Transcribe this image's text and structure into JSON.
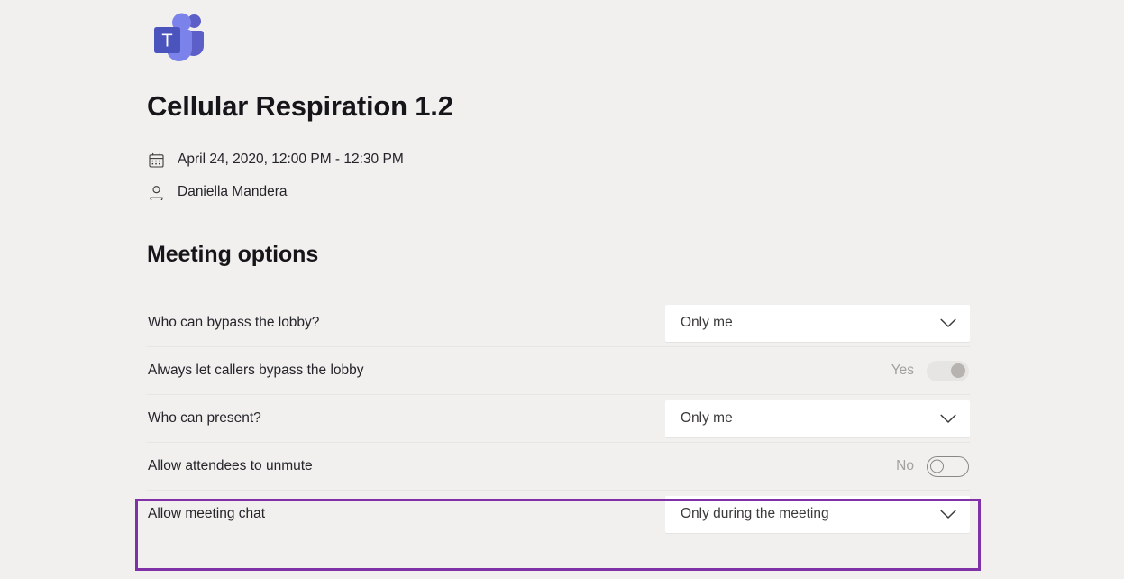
{
  "app": {
    "logo_name": "microsoft-teams-logo",
    "brand_color": "#5b5fc7"
  },
  "meeting": {
    "title": "Cellular Respiration 1.2",
    "date_icon": "calendar-icon",
    "datetime": "April 24, 2020, 12:00 PM - 12:30 PM",
    "organizer_icon": "person-icon",
    "organizer": "Daniella Mandera"
  },
  "section": {
    "heading": "Meeting options"
  },
  "options": [
    {
      "label": "Who can bypass the lobby?",
      "control": "dropdown",
      "value": "Only me",
      "name": "who-can-bypass-lobby",
      "chevron": "chevron-down-icon"
    },
    {
      "label": "Always let callers bypass the lobby",
      "control": "toggle",
      "value": "Yes",
      "state": "on",
      "name": "always-let-callers-bypass-lobby"
    },
    {
      "label": "Who can present?",
      "control": "dropdown",
      "value": "Only me",
      "name": "who-can-present",
      "chevron": "chevron-down-icon"
    },
    {
      "label": "Allow attendees to unmute",
      "control": "toggle",
      "value": "No",
      "state": "off",
      "name": "allow-attendees-to-unmute"
    },
    {
      "label": "Allow meeting chat",
      "control": "dropdown",
      "value": "Only during the meeting",
      "name": "allow-meeting-chat",
      "chevron": "chevron-down-icon"
    }
  ],
  "highlight": {
    "color": "#8031a7",
    "target": "allow-meeting-chat"
  }
}
